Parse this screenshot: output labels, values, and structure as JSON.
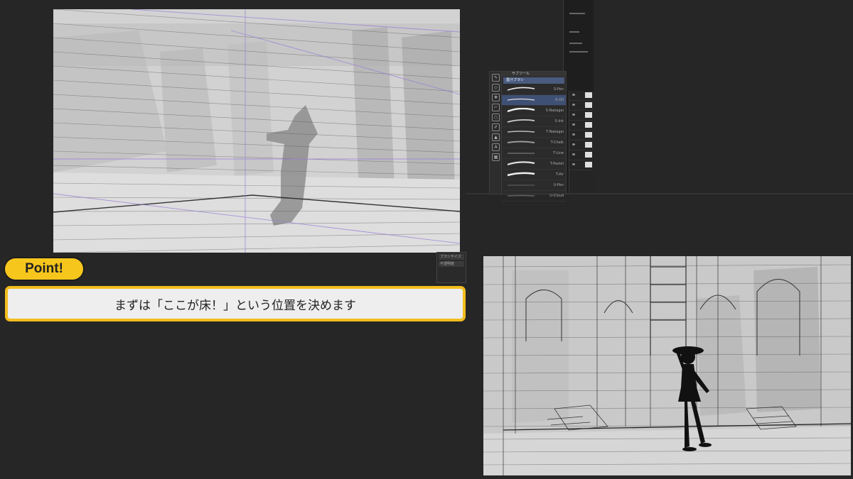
{
  "point_badge": {
    "label": "Point!"
  },
  "caption": {
    "text": "まずは「ここが床！」という位置を決めます"
  },
  "brush_panel": {
    "title": "サブツール",
    "category": "墨汁ブラシ",
    "brushes": [
      "S-Pen",
      "S-Oil",
      "S-Nakagai",
      "S-Ink",
      "T-Nakagai",
      "T-Chalk",
      "T-Line",
      "T-Pastel",
      "T-Air",
      "U-Pen",
      "U-Cloud"
    ]
  },
  "mini_panel": {
    "rows": [
      "ブラシサイズ",
      "不透明度"
    ]
  },
  "colors": {
    "accent_yellow": "#f7c61c",
    "caption_border": "#f2bd1d",
    "panel_bg": "#262626",
    "perspective_line": "#9b80d8"
  },
  "icons": [
    "pen-tool-icon",
    "eraser-tool-icon",
    "move-tool-icon",
    "eyedropper-tool-icon",
    "eye-visibility-icon"
  ]
}
